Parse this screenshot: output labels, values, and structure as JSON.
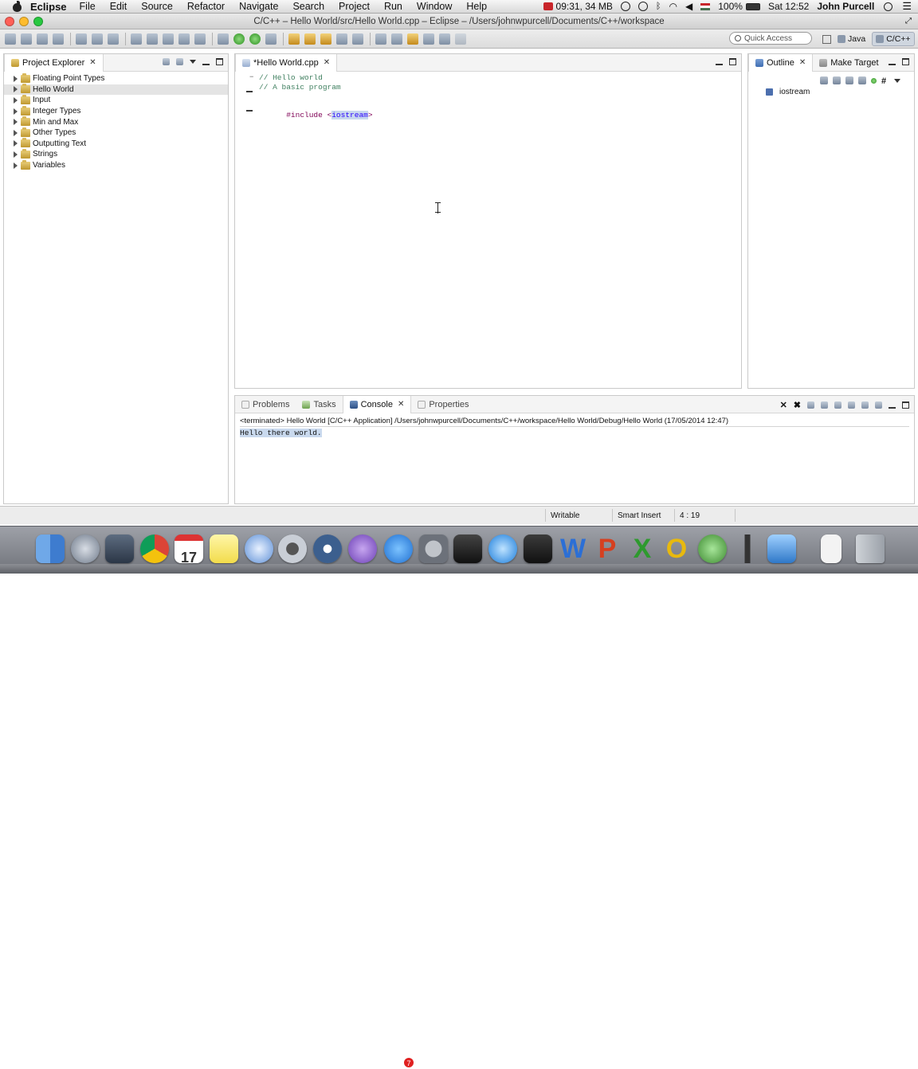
{
  "menubar": {
    "app": "Eclipse",
    "items": [
      "File",
      "Edit",
      "Source",
      "Refactor",
      "Navigate",
      "Search",
      "Project",
      "Run",
      "Window",
      "Help"
    ],
    "status_memory": "09:31, 34 MB",
    "battery": "100%",
    "clock": "Sat 12:52",
    "user": "John Purcell"
  },
  "window": {
    "title": "C/C++ – Hello World/src/Hello World.cpp – Eclipse – /Users/johnwpurcell/Documents/C++/workspace"
  },
  "toolbar": {
    "quick_access_placeholder": "Quick Access",
    "perspectives": [
      {
        "label": "Java",
        "active": false
      },
      {
        "label": "C/C++",
        "active": true
      }
    ]
  },
  "explorer": {
    "title": "Project Explorer",
    "items": [
      {
        "label": "Floating Point Types",
        "selected": false
      },
      {
        "label": "Hello World",
        "selected": true
      },
      {
        "label": "Input",
        "selected": false
      },
      {
        "label": "Integer Types",
        "selected": false
      },
      {
        "label": "Min and Max",
        "selected": false
      },
      {
        "label": "Other Types",
        "selected": false
      },
      {
        "label": "Outputting Text",
        "selected": false
      },
      {
        "label": "Strings",
        "selected": false
      },
      {
        "label": "Variables",
        "selected": false
      }
    ]
  },
  "editor": {
    "tab": "*Hello World.cpp",
    "lines": {
      "c1": "// Hello world",
      "c2": "// A basic program",
      "inc_kw": "#include ",
      "inc_open": "<",
      "inc_hdr": "iostream",
      "inc_close": ">"
    }
  },
  "outline": {
    "tabs": [
      "Outline",
      "Make Target"
    ],
    "item": "iostream"
  },
  "console": {
    "tabs": [
      "Problems",
      "Tasks",
      "Console",
      "Properties"
    ],
    "active_tab": "Console",
    "terminated": "<terminated> Hello World [C/C++ Application] /Users/johnwpurcell/Documents/C++/workspace/Hello World/Debug/Hello World (17/05/2014 12:47)",
    "output": "Hello there world."
  },
  "statusbar": {
    "writable": "Writable",
    "insert_mode": "Smart Insert",
    "position": "4 : 19"
  },
  "dock": {
    "calendar_day": "17",
    "appstore_badge": "7"
  }
}
